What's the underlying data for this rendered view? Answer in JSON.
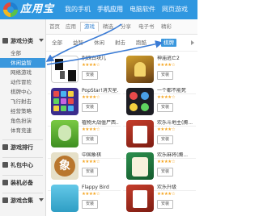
{
  "app": {
    "title": "应用宝"
  },
  "top_nav": [
    {
      "label": "我的手机",
      "active": false
    },
    {
      "label": "手机应用",
      "active": true
    },
    {
      "label": "电脑软件",
      "active": false
    },
    {
      "label": "网页游戏",
      "active": false
    }
  ],
  "sidebar": {
    "sections": [
      {
        "label": "游戏分类",
        "icon": "grid-icon",
        "expanded": true,
        "items": [
          {
            "label": "全部",
            "active": false
          },
          {
            "label": "休闲益智",
            "active": true
          },
          {
            "label": "网络游戏",
            "active": false
          },
          {
            "label": "动作冒险",
            "active": false
          },
          {
            "label": "棋牌中心",
            "active": false
          },
          {
            "label": "飞行射击",
            "active": false
          },
          {
            "label": "经营策略",
            "active": false
          },
          {
            "label": "角色扮演",
            "active": false
          },
          {
            "label": "体育竞速",
            "active": false
          }
        ]
      },
      {
        "label": "游戏排行",
        "icon": "ranking-icon"
      },
      {
        "label": "礼包中心",
        "icon": "gift-icon"
      },
      {
        "label": "装机必备",
        "icon": "package-icon"
      },
      {
        "label": "游戏合集",
        "icon": "collection-icon"
      }
    ]
  },
  "sub_tabs": [
    {
      "label": "首页",
      "active": false
    },
    {
      "label": "应用",
      "active": false
    },
    {
      "label": "游戏",
      "active": true
    },
    {
      "label": "精选",
      "active": false
    },
    {
      "label": "分享",
      "active": false
    },
    {
      "label": "电子书",
      "active": false
    },
    {
      "label": "精彩",
      "active": false
    }
  ],
  "filter_tabs": [
    {
      "label": "全部",
      "active": false
    },
    {
      "label": "益智",
      "active": false
    },
    {
      "label": "休闲",
      "active": false
    },
    {
      "label": "射击",
      "active": false
    },
    {
      "label": "跑酷",
      "active": false
    },
    {
      "label": "棋牌",
      "active": true
    }
  ],
  "apps": [
    {
      "name": "别踩白块儿",
      "thumb": "tiles",
      "install": "安装",
      "rating": "★★★★☆"
    },
    {
      "name": "神庙逃亡2",
      "thumb": "temple",
      "install": "安装",
      "rating": "★★★★☆"
    },
    {
      "name": "PopStar!消灭星...",
      "thumb": "pop",
      "install": "安装",
      "rating": "★★★★☆"
    },
    {
      "name": "一个都不能死",
      "thumb": "check",
      "install": "安装",
      "rating": "★★★★☆"
    },
    {
      "name": "植物大战僵尸西...",
      "thumb": "pvz",
      "install": "安装",
      "rating": "★★★★☆"
    },
    {
      "name": "欢乐斗地主(腾...",
      "thumb": "poker",
      "install": "安装",
      "rating": "★★★★☆"
    },
    {
      "name": "中国象棋",
      "thumb": "chess",
      "install": "安装",
      "rating": "★★★★☆",
      "glyph": "象"
    },
    {
      "name": "欢乐麻将(腾...",
      "thumb": "mahjong",
      "install": "安装",
      "rating": "★★★★☆"
    },
    {
      "name": "Flappy Bird",
      "thumb": "bird",
      "install": "安装",
      "rating": "★★★★☆"
    },
    {
      "name": "欢乐升级",
      "thumb": "poker",
      "install": "安装",
      "rating": "★★★★☆"
    }
  ],
  "colors": {
    "header": "#2f97e0",
    "accent": "#3a97dd",
    "annotation_arrow": "#3a7bd5"
  }
}
